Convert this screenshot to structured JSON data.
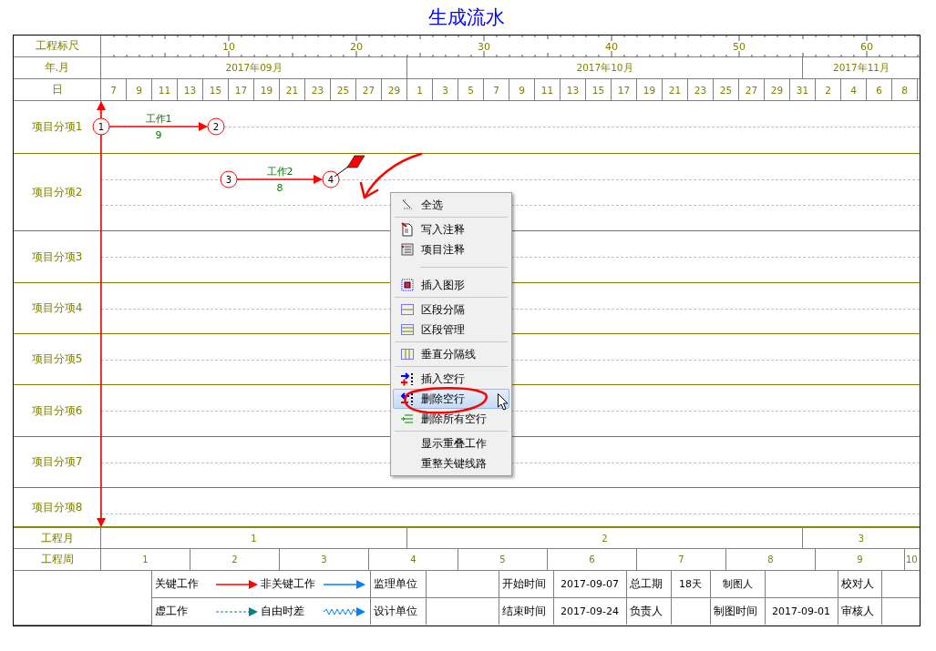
{
  "title": "生成流水",
  "ruler": {
    "label": "工程标尺",
    "ticks": [
      "10",
      "20",
      "30",
      "40",
      "50",
      "60"
    ]
  },
  "calendar": {
    "month_label": "年.月",
    "months": [
      "2017年09月",
      "2017年10月",
      "2017年11月"
    ],
    "day_label": "日",
    "days": [
      "7",
      "9",
      "11",
      "13",
      "15",
      "17",
      "19",
      "21",
      "23",
      "25",
      "27",
      "29",
      "1",
      "3",
      "5",
      "7",
      "9",
      "11",
      "13",
      "15",
      "17",
      "19",
      "21",
      "23",
      "25",
      "27",
      "29",
      "31",
      "2",
      "4",
      "6",
      "8"
    ]
  },
  "rows": [
    {
      "label": "项目分项1",
      "works": [
        {
          "name": "工作1",
          "duration": "9",
          "kind": "critical",
          "start_node": "1",
          "end_node": "2"
        }
      ]
    },
    {
      "label": "项目分项2",
      "works": [
        {
          "name": "工作2",
          "duration": "8",
          "kind": "critical",
          "start_node": "3",
          "end_node": "4"
        }
      ]
    },
    {
      "label": "项目分项3",
      "works": []
    },
    {
      "label": "项目分项4",
      "works": []
    },
    {
      "label": "项目分项5",
      "works": []
    },
    {
      "label": "项目分项6",
      "works": []
    },
    {
      "label": "项目分项7",
      "works": []
    },
    {
      "label": "项目分项8",
      "works": []
    }
  ],
  "context_menu": {
    "groups": [
      [
        {
          "label": "全选",
          "selected": false
        }
      ],
      [
        {
          "label": "写入注释",
          "selected": false
        },
        {
          "label": "项目注释",
          "selected": false
        }
      ],
      [
        {
          "label": "插入图形",
          "selected": false
        }
      ],
      [
        {
          "label": "区段分隔",
          "selected": false
        },
        {
          "label": "区段管理",
          "selected": false
        }
      ],
      [
        {
          "label": "垂直分隔线",
          "selected": false
        }
      ],
      [
        {
          "label": "插入空行",
          "selected": false
        },
        {
          "label": "删除空行",
          "selected": true
        },
        {
          "label": "删除所有空行",
          "selected": false
        }
      ],
      [
        {
          "label": "显示重叠工作",
          "selected": false
        },
        {
          "label": "重整关键线路",
          "selected": false
        }
      ]
    ]
  },
  "project_months": {
    "label": "工程月",
    "values": [
      "1",
      "2",
      "3"
    ]
  },
  "project_weeks": {
    "label": "工程周",
    "values": [
      "1",
      "2",
      "3",
      "4",
      "5",
      "6",
      "7",
      "8",
      "9",
      "10"
    ]
  },
  "legend": [
    {
      "label": "关键工作",
      "kind": "critical"
    },
    {
      "label": "非关键工作",
      "kind": "noncritical"
    },
    {
      "label": "虚工作",
      "kind": "dummy"
    },
    {
      "label": "自由时差",
      "kind": "float"
    }
  ],
  "info": {
    "supervisor_label": "监理单位",
    "designer_label": "设计单位",
    "start_label": "开始时间",
    "start": "2017-09-07",
    "end_label": "结束时间",
    "end": "2017-09-24",
    "duration_label": "总工期",
    "duration": "18天",
    "owner_label": "负责人",
    "drafter_label": "制图人",
    "draw_time_label": "制图时间",
    "draw_time": "2017-09-01",
    "checker_label": "校对人",
    "reviewer_label": "审核人"
  }
}
